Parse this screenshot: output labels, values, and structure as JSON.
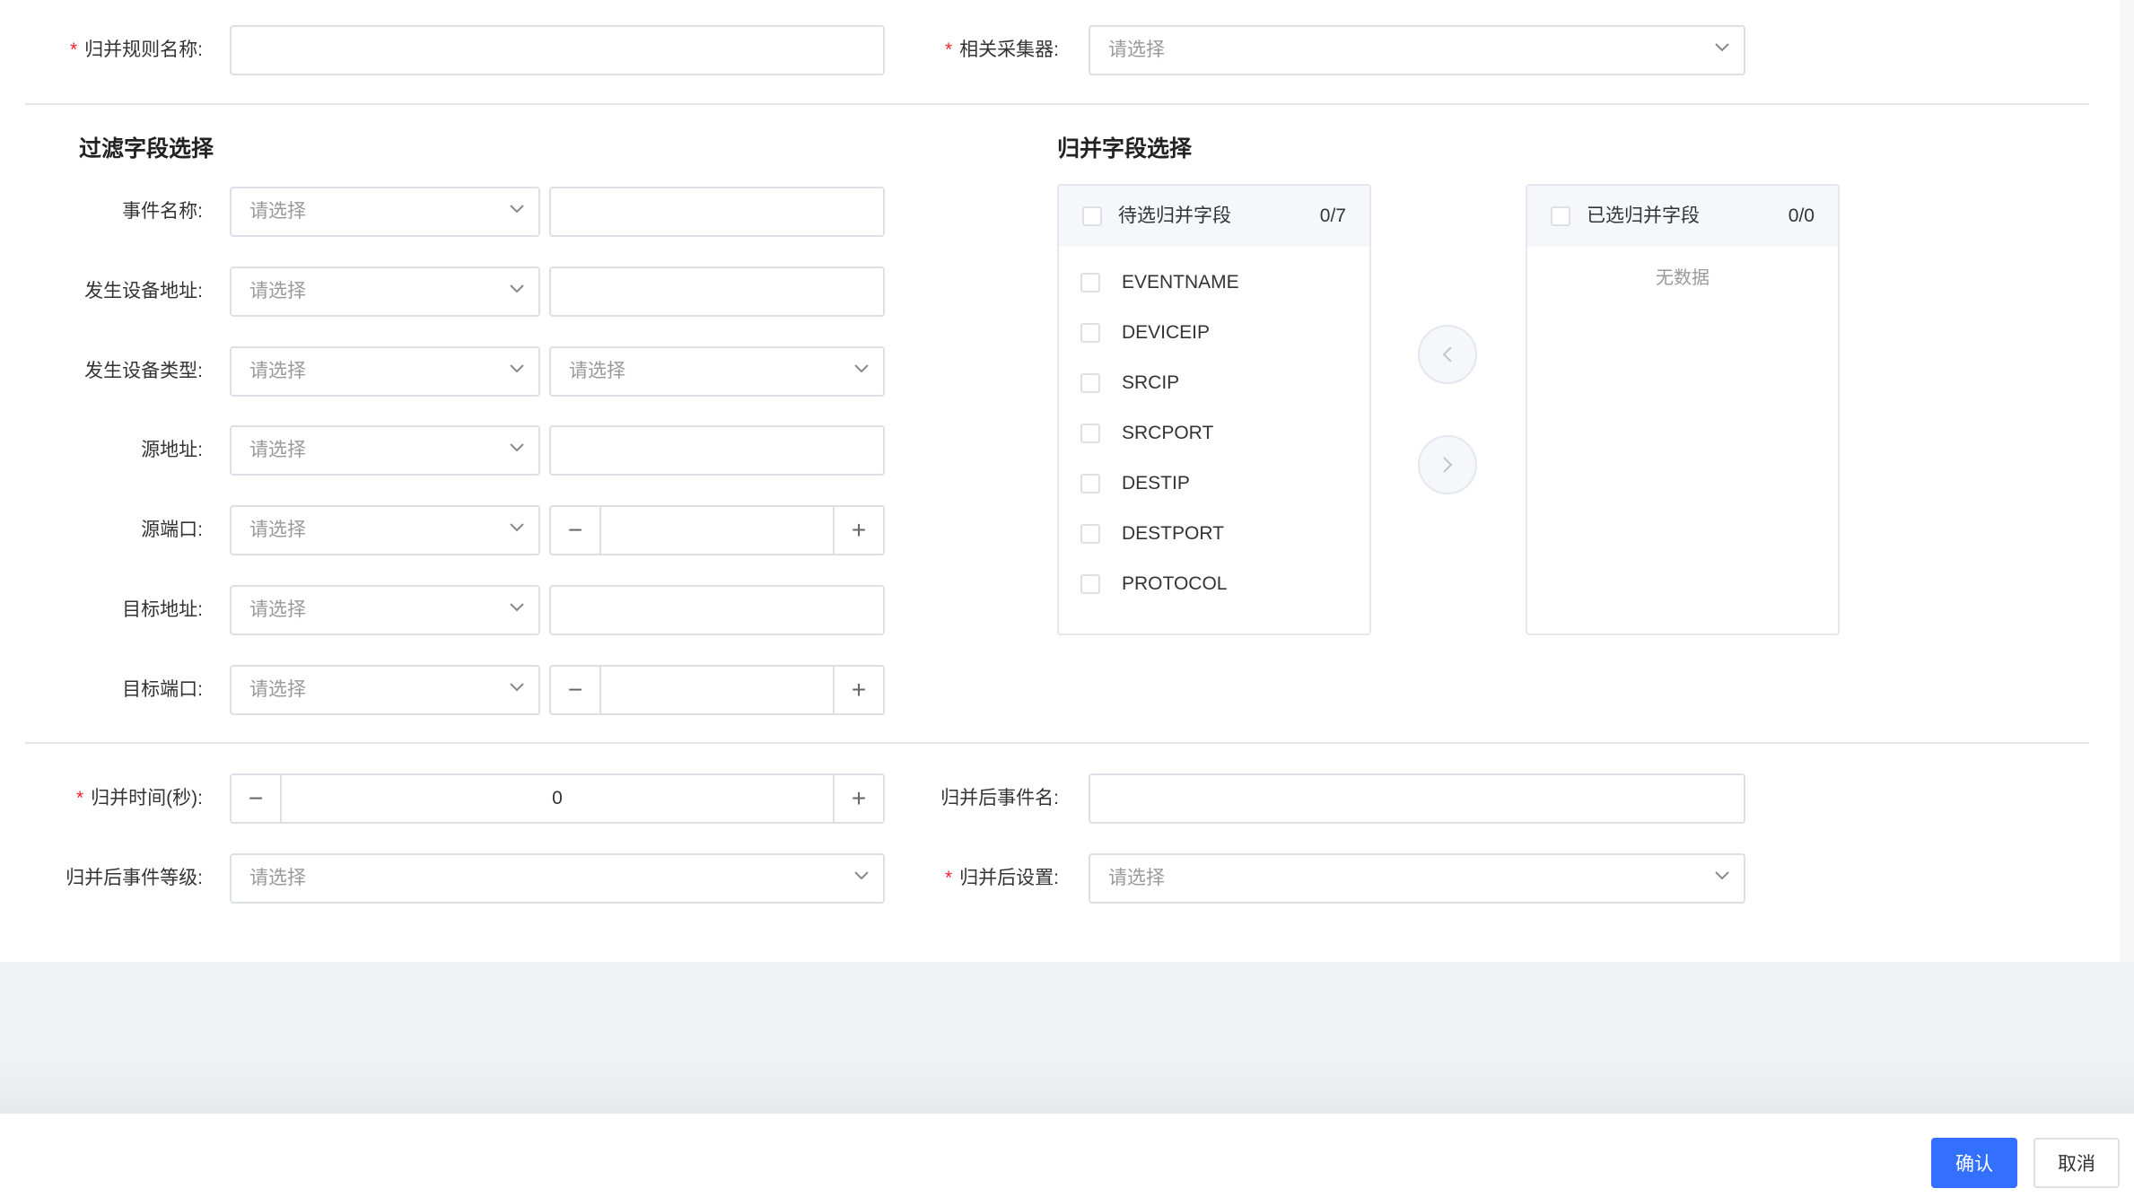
{
  "top": {
    "rule_name_label": "归并规则名称:",
    "collector_label": "相关采集器:",
    "collector_placeholder": "请选择"
  },
  "filter": {
    "title": "过滤字段选择",
    "select_placeholder": "请选择",
    "rows": [
      {
        "label": "事件名称:"
      },
      {
        "label": "发生设备地址:"
      },
      {
        "label": "发生设备类型:"
      },
      {
        "label": "源地址:"
      },
      {
        "label": "源端口:"
      },
      {
        "label": "目标地址:"
      },
      {
        "label": "目标端口:"
      }
    ]
  },
  "merge_fields": {
    "title": "归并字段选择",
    "left_title": "待选归并字段",
    "left_count": "0/7",
    "right_title": "已选归并字段",
    "right_count": "0/0",
    "empty_text": "无数据",
    "items": [
      "EVENTNAME",
      "DEVICEIP",
      "SRCIP",
      "SRCPORT",
      "DESTIP",
      "DESTPORT",
      "PROTOCOL"
    ]
  },
  "bottom": {
    "merge_time_label": "归并时间(秒):",
    "merge_time_value": "0",
    "merged_event_name_label": "归并后事件名:",
    "merged_level_label": "归并后事件等级:",
    "merged_level_placeholder": "请选择",
    "merged_setting_label": "归并后设置:",
    "merged_setting_placeholder": "请选择"
  },
  "footer": {
    "confirm": "确认",
    "cancel": "取消"
  },
  "colors": {
    "primary": "#3370ff",
    "required": "#f5222d"
  }
}
